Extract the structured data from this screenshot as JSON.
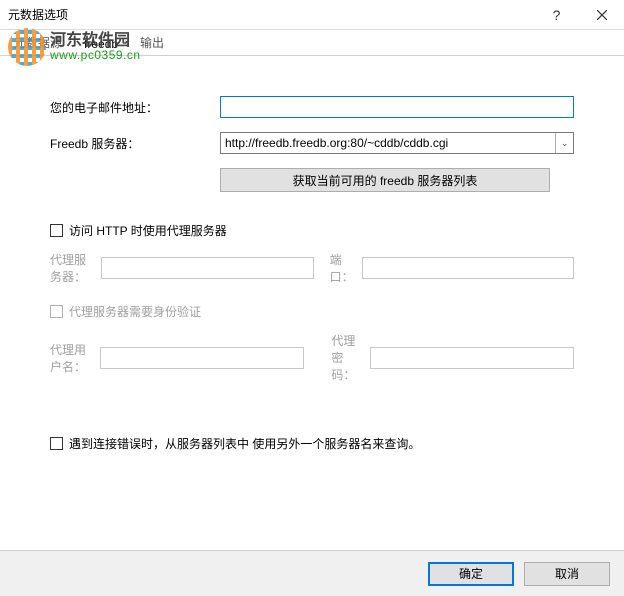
{
  "window": {
    "title": "元数据选项"
  },
  "watermark": {
    "brand": "河东软件园",
    "url": "www.pc0359.cn"
  },
  "tabs": {
    "t0": "元数据源",
    "t1": "freedb",
    "t2": "输出"
  },
  "form": {
    "email_label": "您的电子邮件地址：",
    "email_value": "",
    "server_label": "Freedb 服务器：",
    "server_value": "http://freedb.freedb.org:80/~cddb/cddb.cgi",
    "fetch_btn": "获取当前可用的 freedb 服务器列表"
  },
  "proxy": {
    "use_proxy_label": "访问 HTTP 时使用代理服务器",
    "server_label": "代理服务器：",
    "port_label": "端口：",
    "auth_label": "代理服务器需要身份验证",
    "user_label": "代理用户名：",
    "pass_label": "代理密码："
  },
  "retry": {
    "label": "遇到连接错误时，从服务器列表中 使用另外一个服务器名来查询。"
  },
  "footer": {
    "ok": "确定",
    "cancel": "取消"
  }
}
